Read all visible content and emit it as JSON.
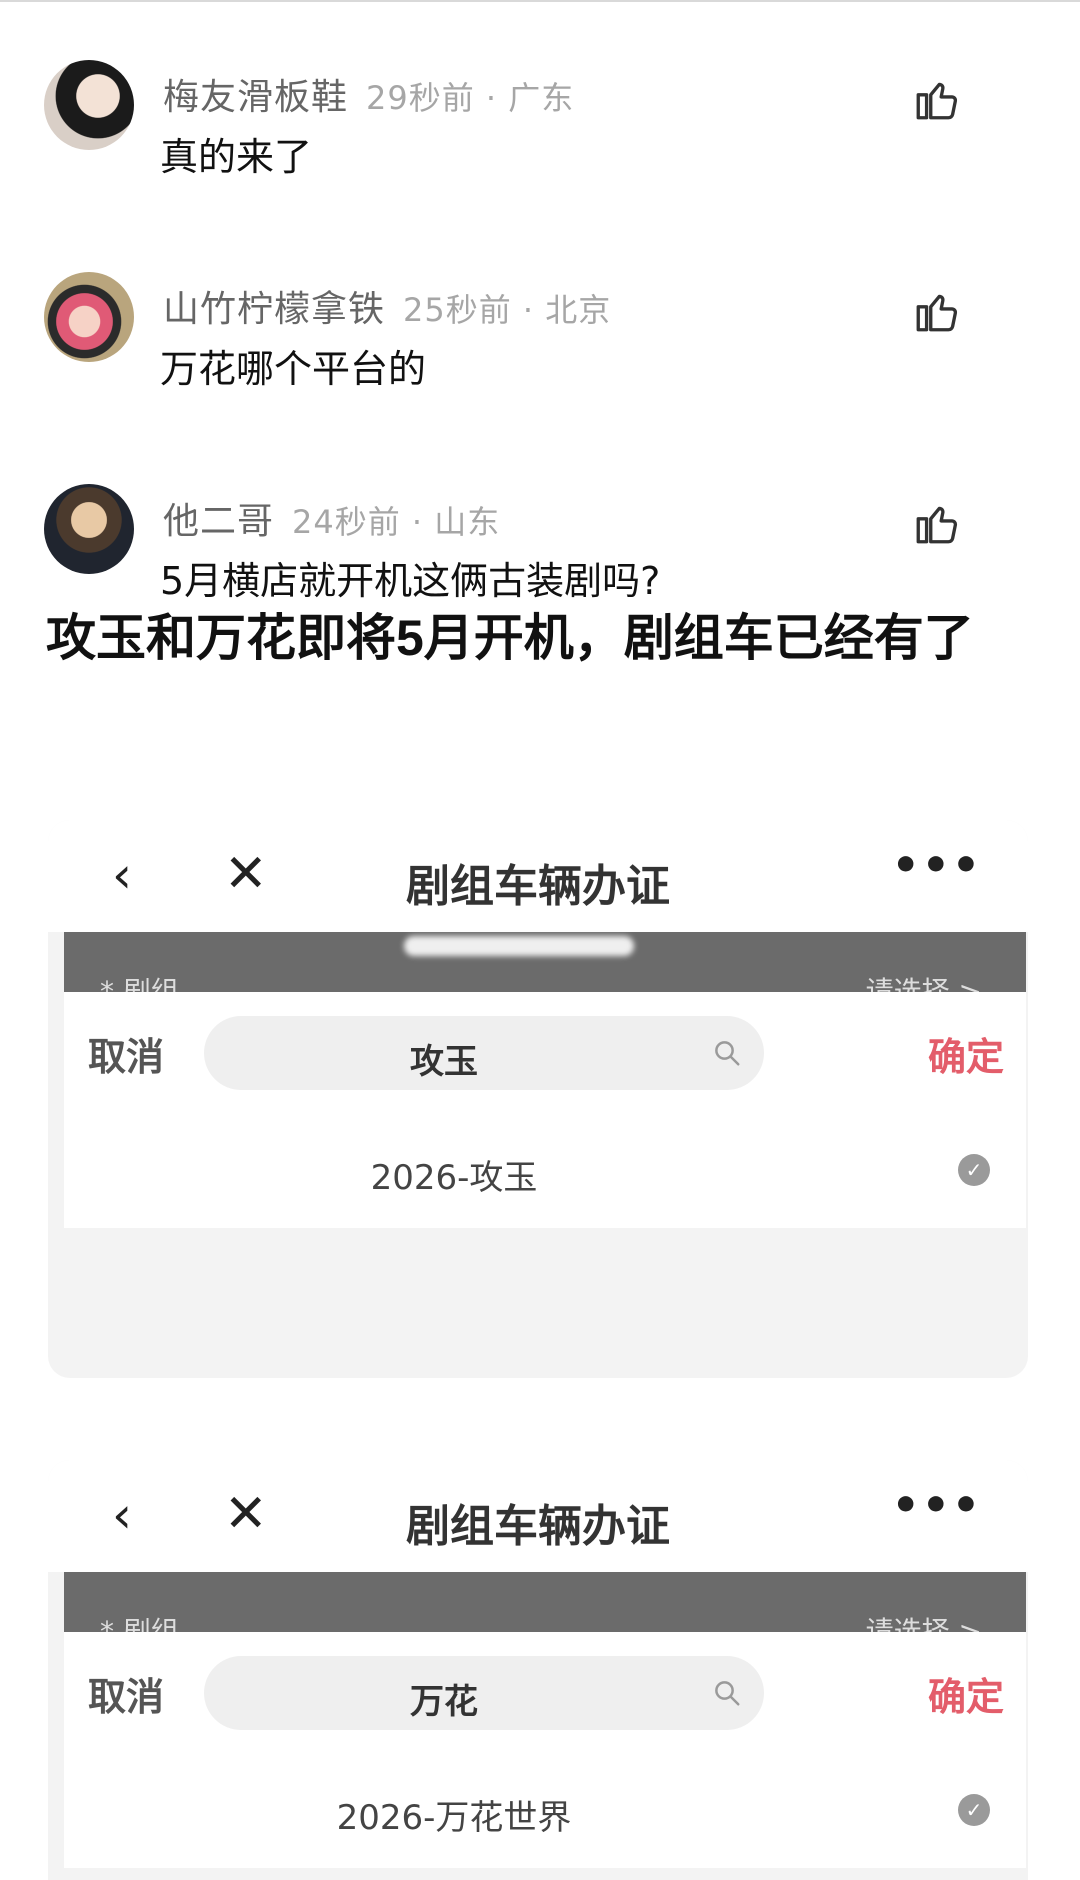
{
  "comments": [
    {
      "username": "梅友滑板鞋",
      "time": "29秒前",
      "location": "广东",
      "text": "真的来了"
    },
    {
      "username": "山竹柠檬拿铁",
      "time": "25秒前",
      "location": "北京",
      "text": "万花哪个平台的"
    },
    {
      "username": "他二哥",
      "time": "24秒前",
      "location": "山东",
      "text": "5月横店就开机这俩古装剧吗?"
    }
  ],
  "headline": "攻玉和万花即将5月开机，剧组车已经有了",
  "screens": [
    {
      "title": "剧组车辆办证",
      "field_label": "* 剧组",
      "field_hint": "请选择 >",
      "cancel": "取消",
      "search_value": "攻玉",
      "confirm": "确定",
      "result": "2026-攻玉"
    },
    {
      "title": "剧组车辆办证",
      "field_label": "* 剧组",
      "field_hint": "请选择 >",
      "cancel": "取消",
      "search_value": "万花",
      "confirm": "确定",
      "result": "2026-万花世界"
    }
  ],
  "icons": {
    "like": "thumb-up-icon",
    "back": "chevron-left-icon",
    "close": "close-icon",
    "more": "more-icon",
    "search": "search-icon",
    "check": "check-circle-icon"
  },
  "colors": {
    "confirm": "#e35d6a",
    "meta": "#a6a6a6",
    "username": "#666666"
  }
}
